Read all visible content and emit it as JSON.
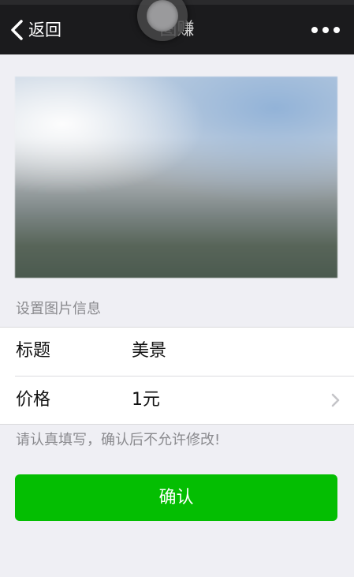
{
  "nav": {
    "back_label": "返回",
    "title": "图赚"
  },
  "photo": {
    "description_icon": "landscape-photo"
  },
  "form": {
    "section_title": "设置图片信息",
    "rows": [
      {
        "label": "标题",
        "value": "美景"
      },
      {
        "label": "价格",
        "value": "1元"
      }
    ],
    "hint": "请认真填写，确认后不允许修改!"
  },
  "confirm": {
    "label": "确认"
  },
  "colors": {
    "nav_bg": "#1b1b1d",
    "page_bg": "#efeff4",
    "confirm_bg": "#04be02"
  }
}
